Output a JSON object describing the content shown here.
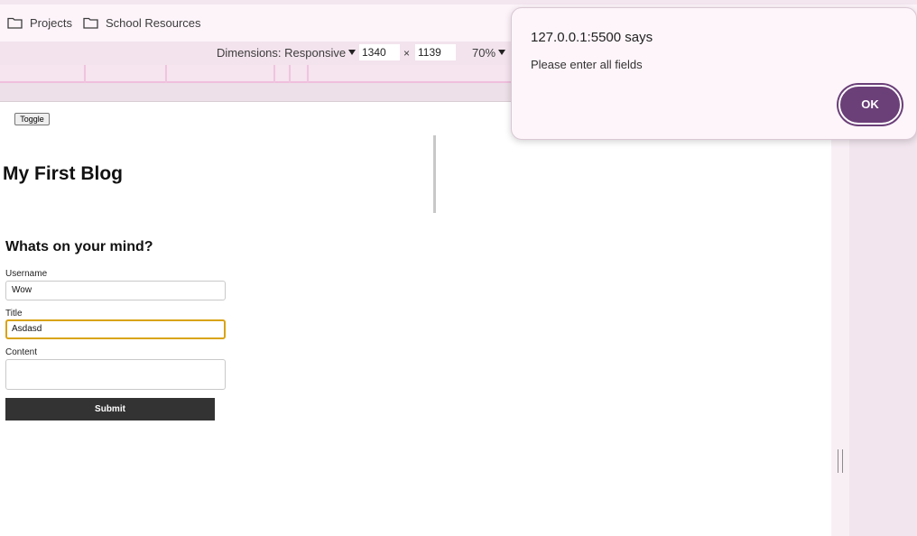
{
  "bookmarks": [
    {
      "label": "Projects",
      "icon": "folder-icon"
    },
    {
      "label": "School Resources",
      "icon": "folder-icon"
    }
  ],
  "device_toolbar": {
    "dimensions_label": "Dimensions: Responsive",
    "width": "1340",
    "times": "×",
    "height": "1139",
    "zoom": "70%"
  },
  "page": {
    "toggle_label": "Toggle",
    "blog_title": "My First Blog",
    "form_heading": "Whats on your mind?",
    "username_label": "Username",
    "username_value": "Wow",
    "title_label": "Title",
    "title_value": "Asdasd",
    "content_label": "Content",
    "submit_label": "Submit"
  },
  "dialog": {
    "origin": "127.0.0.1:5500 says",
    "message": "Please enter all fields",
    "ok_label": "OK"
  },
  "colors": {
    "dialog_button": "#6b3f78",
    "focus_outline": "#d9a312",
    "submit_bg": "#333333"
  }
}
